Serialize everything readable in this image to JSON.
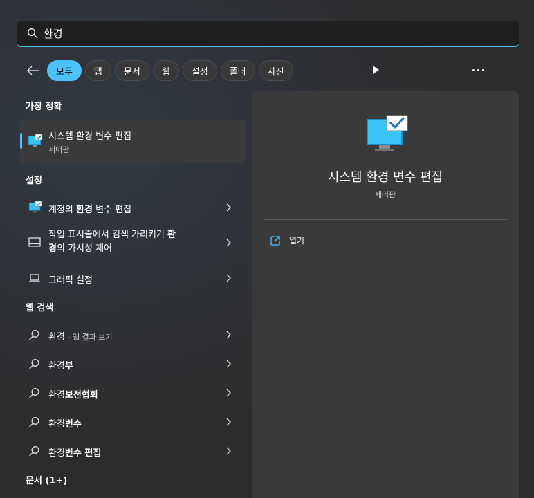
{
  "search": {
    "query": "환경"
  },
  "filters": [
    {
      "label": "모두",
      "active": true
    },
    {
      "label": "앱"
    },
    {
      "label": "문서"
    },
    {
      "label": "웹"
    },
    {
      "label": "설정"
    },
    {
      "label": "폴더"
    },
    {
      "label": "사진"
    }
  ],
  "best_match": {
    "heading": "가장 정확",
    "title": "시스템 환경 변수 편집",
    "subtitle": "제어판"
  },
  "settings": {
    "heading": "설정",
    "items": [
      {
        "pre": "계정의 ",
        "bold": "환경",
        "post": " 변수 편집"
      },
      {
        "line1_pre": "작업 표시줄에서 검색 가리키기 ",
        "line1_bold": "환",
        "line2_bold": "경",
        "line2_post": "의 가시성 제어"
      },
      {
        "label": "그래픽 설정"
      }
    ]
  },
  "web": {
    "heading": "웹 검색",
    "items": [
      {
        "pre": "환경",
        "small": " - 웹 결과 보기"
      },
      {
        "pre": "환경",
        "bold": "부"
      },
      {
        "pre": "환경",
        "bold": "보전협회"
      },
      {
        "pre": "환경",
        "bold": "변수"
      },
      {
        "pre": "환경",
        "bold": "변수 편집"
      }
    ]
  },
  "documents": {
    "heading": "문서 (1+)"
  },
  "preview": {
    "title": "시스템 환경 변수 편집",
    "subtitle": "제어판",
    "open_label": "열기"
  },
  "colors": {
    "accent": "#4cc2ff",
    "panel": "#3a3a3a",
    "background": "#2c2c2c"
  },
  "icons": {
    "search": "search-icon",
    "back": "arrow-left-icon",
    "play": "play-icon",
    "more": "more-icon",
    "monitor": "monitor-check-icon",
    "taskbar": "taskbar-icon",
    "laptop": "laptop-icon",
    "web": "web-search-icon",
    "chevron": "chevron-right-icon",
    "open": "open-external-icon"
  }
}
